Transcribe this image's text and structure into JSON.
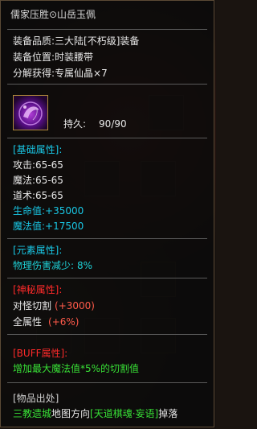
{
  "item": {
    "name": "儒家压胜⊙山岳玉佩",
    "quality_label": "装备品质:",
    "quality_value": "三大陆[不朽级]装备",
    "slot_label": "装备位置:",
    "slot_value": "时装腰带",
    "decompose_label": "分解获得:",
    "decompose_value": "专属仙晶×7",
    "durability_label": "持久:",
    "durability_value": "90/90",
    "icon": "purple-jade-pendant-icon"
  },
  "base_attrs": {
    "header": "[基础属性]:",
    "rows": [
      {
        "label": "攻击:",
        "value": "65-65"
      },
      {
        "label": "魔法:",
        "value": "65-65"
      },
      {
        "label": "道术:",
        "value": "65-65"
      }
    ],
    "hp_label": "生命值:",
    "hp_value": "+35000",
    "mp_label": "魔法值:",
    "mp_value": "+17500"
  },
  "element_attrs": {
    "header": "[元素属性]:",
    "row_label": "物理伤害减少:",
    "row_value": "8%"
  },
  "mystic_attrs": {
    "header": "[神秘属性]:",
    "row1_label": "对怪切割",
    "row1_value": "(+3000)",
    "row2_label": "全属性",
    "row2_value": "(+6%)"
  },
  "buff_attrs": {
    "header": "[BUFF属性]:",
    "text": "增加最大魔法值*5%的切割值"
  },
  "origin": {
    "header": "[物品出处]",
    "place": "三教遗城",
    "mid": "地图方向",
    "boss": "[天道棋魂·妄语]",
    "suffix": "掉落"
  },
  "colors": {
    "cyan": "#19c7e5",
    "red": "#ff2a2a",
    "green": "#38e036",
    "salmon": "#ff5a4a"
  }
}
